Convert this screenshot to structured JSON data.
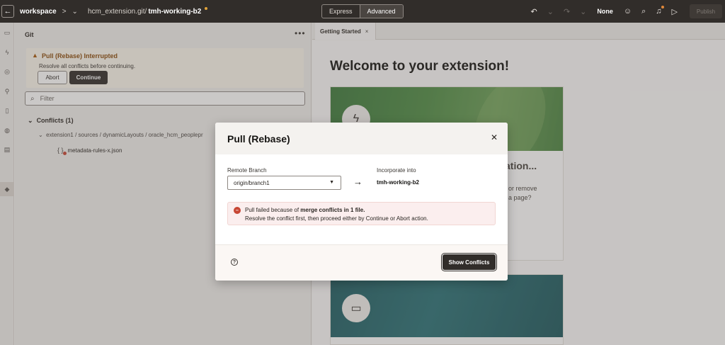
{
  "topbar": {
    "back_icon": "arrow-left-icon",
    "workspace": "workspace",
    "path": "hcm_extension.git/",
    "branch": "tmh-working-b2",
    "mode_express": "Express",
    "mode_advanced": "Advanced",
    "undo_icon": "undo-icon",
    "redo_icon": "redo-icon",
    "selector": "None",
    "publish": "Publish",
    "unsaved_dot_color": "#e0a33a"
  },
  "rail": {
    "icons": [
      "monitor-icon",
      "lightning-icon",
      "target-icon",
      "wrench-icon",
      "mobile-icon",
      "globe-icon",
      "document-icon",
      "git-icon"
    ]
  },
  "git": {
    "title": "Git",
    "more_label": "•••",
    "warning_title": "Pull (Rebase) Interrupted",
    "warning_text": "Resolve all conflicts before continuing.",
    "abort_label": "Abort",
    "continue_label": "Continue",
    "filter_placeholder": "Filter",
    "conflicts_header": "Conflicts (1)",
    "conflict_path": "extension1 / sources / dynamicLayouts / oracle_hcm_peoplepr",
    "conflict_file": "metadata-rules-x.json"
  },
  "editor": {
    "tab_label": "Getting Started",
    "welcome": "Welcome to your extension!",
    "card1_title": "ation...",
    "card1_line1": "or remove",
    "card1_line2": "a page?"
  },
  "dialog": {
    "title": "Pull (Rebase)",
    "remote_label": "Remote Branch",
    "remote_value": "origin/branch1",
    "incorporate_label": "Incorporate into",
    "incorporate_value": "tmh-working-b2",
    "error_prefix": "Pull failed because of ",
    "error_bold": "merge conflicts in 1 file.",
    "error_line2": "Resolve the conflict first, then proceed either by Continue or Abort action.",
    "show_conflicts_label": "Show Conflicts",
    "error_color": "#c74634"
  }
}
